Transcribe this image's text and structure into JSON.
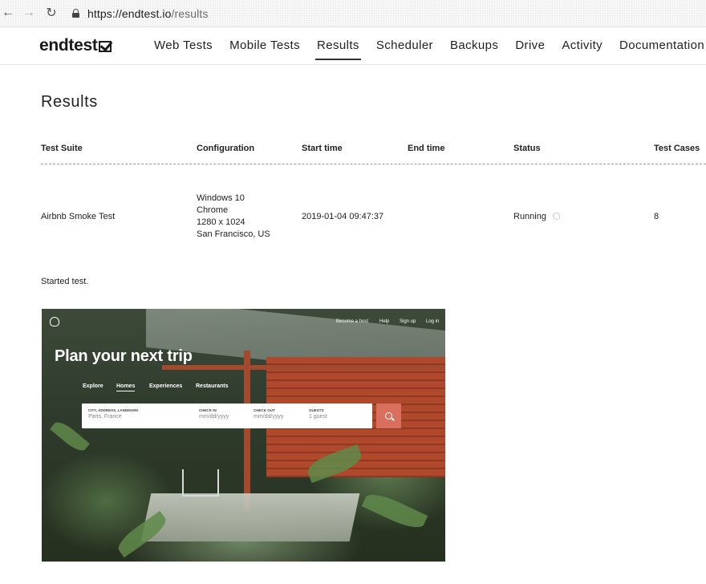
{
  "browser": {
    "url_host": "https://endtest.io",
    "url_path": "/results"
  },
  "header": {
    "logo_text": "endtest",
    "nav": [
      {
        "label": "Web Tests"
      },
      {
        "label": "Mobile Tests"
      },
      {
        "label": "Results",
        "active": true
      },
      {
        "label": "Scheduler"
      },
      {
        "label": "Backups"
      },
      {
        "label": "Drive"
      },
      {
        "label": "Activity"
      },
      {
        "label": "Documentation"
      }
    ]
  },
  "page": {
    "title": "Results"
  },
  "table": {
    "columns": [
      "Test Suite",
      "Configuration",
      "Start time",
      "End time",
      "Status",
      "Test Cases"
    ],
    "rows": [
      {
        "test_suite": "Airbnb Smoke Test",
        "configuration": [
          "Windows 10",
          "Chrome",
          "1280 x 1024",
          "San Francisco, US"
        ],
        "start_time": "2019-01-04 09:47:37",
        "end_time": "",
        "status": "Running",
        "test_cases": "8"
      }
    ]
  },
  "log": {
    "message": "Started test."
  },
  "preview": {
    "top_nav": [
      "Become a host",
      "Help",
      "Sign up",
      "Log in"
    ],
    "headline": "Plan your next trip",
    "tabs": [
      "Explore",
      "Homes",
      "Experiences",
      "Restaurants"
    ],
    "active_tab": "Homes",
    "search_fields": [
      {
        "label": "CITY, ADDRESS, LANDMARK",
        "value": "Paris, France"
      },
      {
        "label": "CHECK IN",
        "value": "mm/dd/yyyy"
      },
      {
        "label": "CHECK OUT",
        "value": "mm/dd/yyyy"
      },
      {
        "label": "GUESTS",
        "value": "1 guest"
      }
    ]
  },
  "colors": {
    "accent_search": "#d9705e",
    "wall": "#b0492c"
  }
}
